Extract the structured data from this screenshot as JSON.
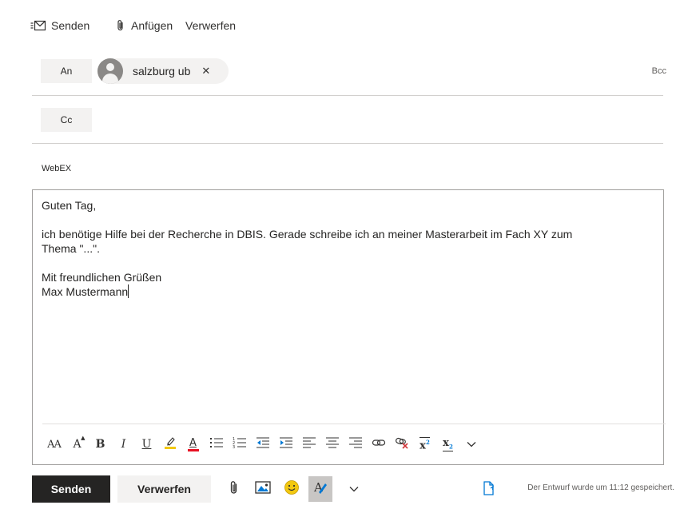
{
  "toolbar": {
    "send": "Senden",
    "attach": "Anfügen",
    "discard": "Verwerfen"
  },
  "to": {
    "label": "An",
    "recipient": "salzburg ub",
    "remove_glyph": "✕",
    "bcc": "Bcc"
  },
  "cc": {
    "label": "Cc"
  },
  "subject": "WebEX",
  "body": {
    "greeting": "Guten Tag,",
    "para_line1": "ich benötige Hilfe bei der Recherche in DBIS. Gerade schreibe ich an meiner Masterarbeit im Fach XY zum",
    "para_line2": "Thema \"...\".",
    "closing": "Mit freundlichen Grüßen",
    "name": "Max Mustermann"
  },
  "format_bar": {
    "font_size_glyph": "AA",
    "grow_font_glyph": "A",
    "bold": "B",
    "italic": "I",
    "underline": "U",
    "font_color_glyph": "A",
    "superscript_glyph": "x",
    "subscript_glyph": "x"
  },
  "bottom": {
    "send": "Senden",
    "discard": "Verwerfen",
    "draft_status": "Der Entwurf wurde um 11:12 gespeichert."
  },
  "colors": {
    "send_button_bg": "#252423",
    "secondary_bg": "#f3f2f1",
    "highlight_yellow": "#f2c811",
    "font_color_red": "#e81123",
    "remove_link_red": "#d13438",
    "indent_blue": "#0078d4"
  }
}
